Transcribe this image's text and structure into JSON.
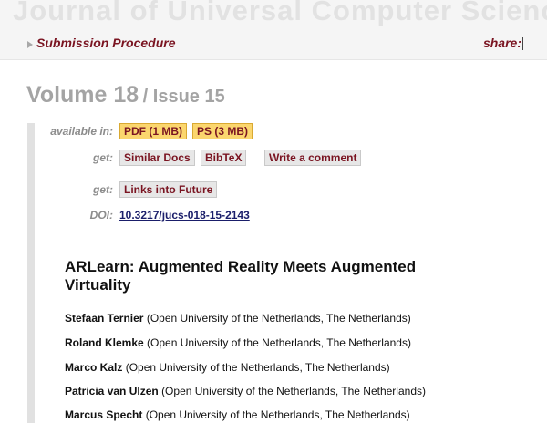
{
  "header": {
    "journal_title": "Journal of Universal Computer Science",
    "submission_label": "Submission Procedure",
    "share_label": "share:"
  },
  "volume": {
    "volume_text": "Volume 18",
    "issue_text": "/ Issue 15"
  },
  "meta": {
    "available_label": "available in:",
    "pdf_button": "PDF (1 MB)",
    "ps_button": "PS (3 MB)",
    "get_label_1": "get:",
    "similar_button": "Similar Docs",
    "bibtex_button": "BibTeX",
    "comment_button": "Write a comment",
    "get_label_2": "get:",
    "future_button": "Links into Future",
    "doi_label": "DOI:",
    "doi_value": "10.3217/jucs-018-15-2143"
  },
  "article": {
    "title": "ARLearn: Augmented Reality Meets Augmented Virtuality",
    "authors": [
      {
        "name": "Stefaan Ternier",
        "affiliation": "(Open University of the Netherlands, The Netherlands)"
      },
      {
        "name": "Roland Klemke",
        "affiliation": "(Open University of the Netherlands, The Netherlands)"
      },
      {
        "name": "Marco Kalz",
        "affiliation": "(Open University of the Netherlands, The Netherlands)"
      },
      {
        "name": "Patricia van Ulzen",
        "affiliation": "(Open University of the Netherlands, The Netherlands)"
      },
      {
        "name": "Marcus Specht",
        "affiliation": "(Open University of the Netherlands, The Netherlands)"
      }
    ]
  },
  "colors": {
    "link": "#7a1421",
    "doi": "#1a1e6a",
    "pdf_highlight": "#fbd66e"
  }
}
